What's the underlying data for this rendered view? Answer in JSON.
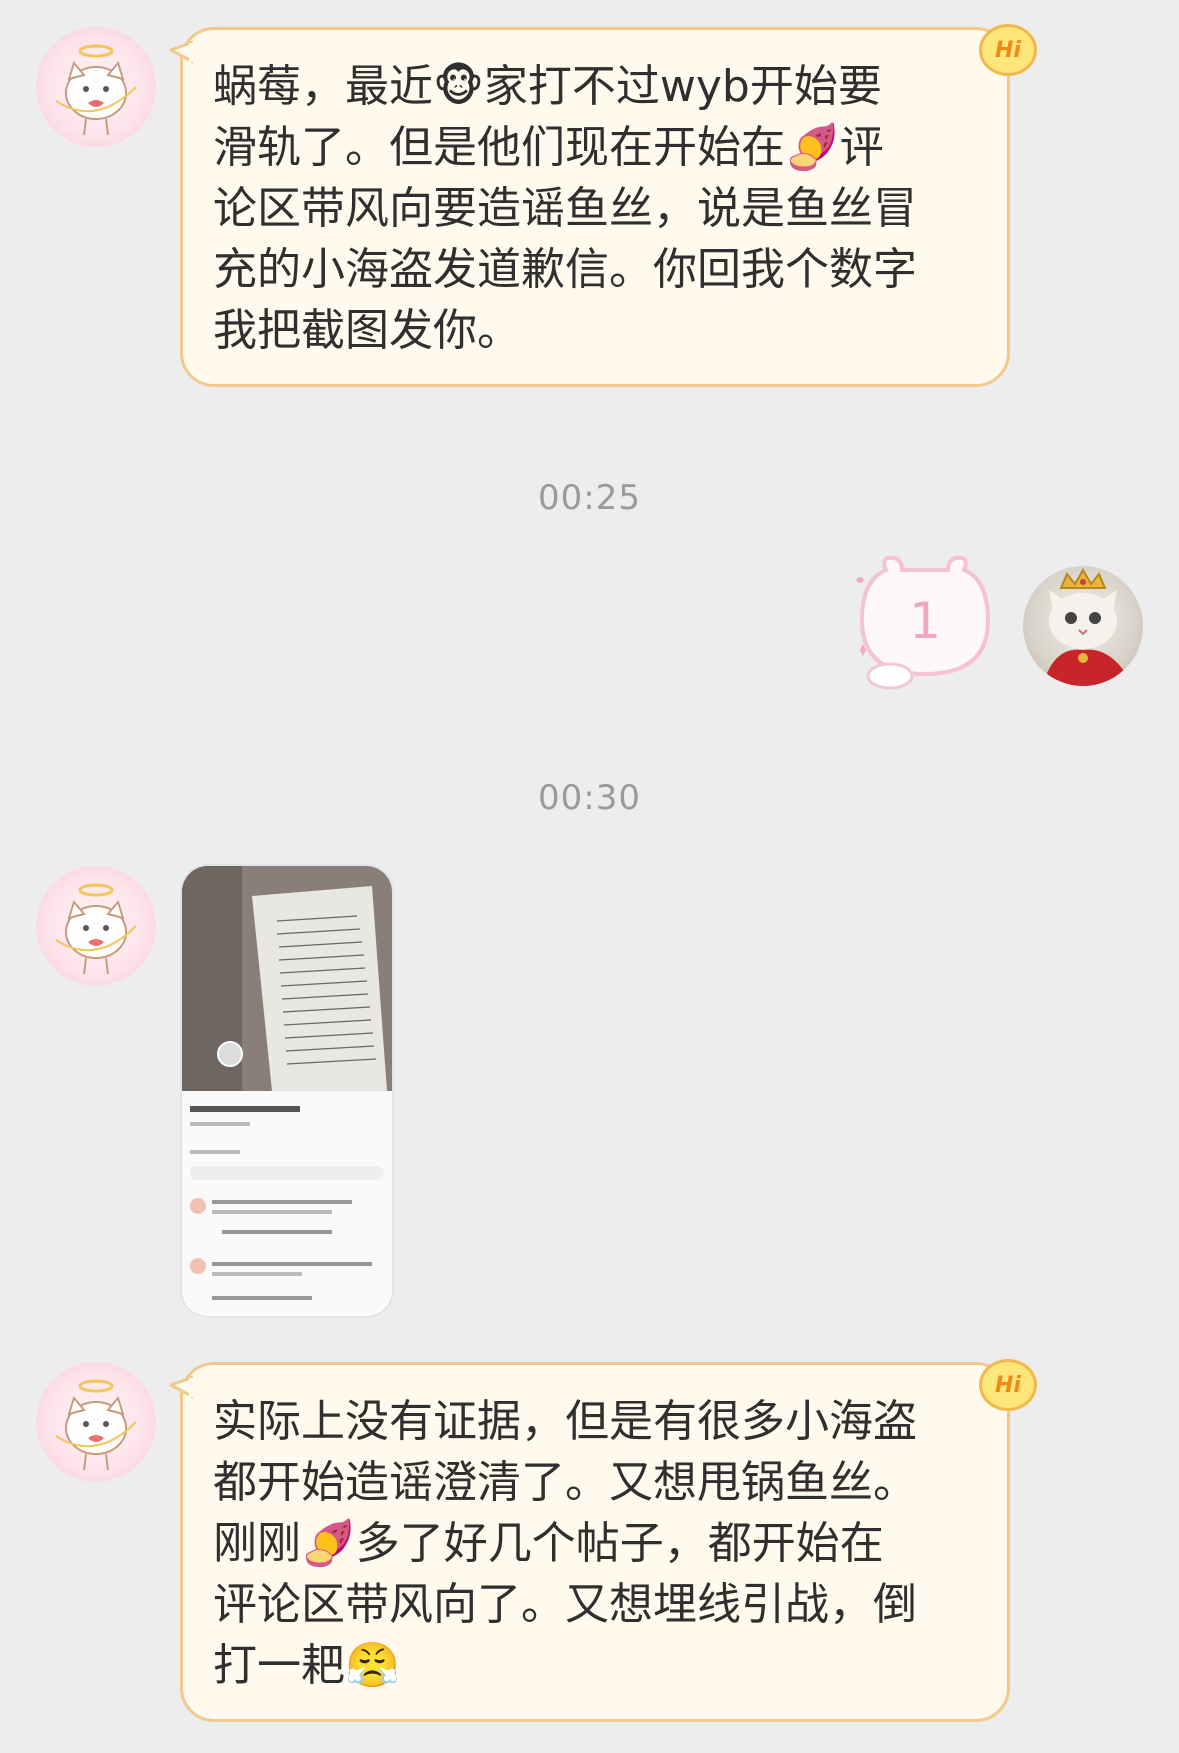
{
  "messages": [
    {
      "sender": "contact",
      "text": "蜗莓，最近🐵家打不过wyb开始要\n滑轨了。但是他们现在开始在🍠评\n论区带风向要造谣鱼丝，说是鱼丝冒\n充的小海盗发道歉信。你回我个数字\n我把截图发你。"
    },
    {
      "timestamp": "00:25"
    },
    {
      "sender": "me",
      "sticker_text": "1"
    },
    {
      "timestamp": "00:30"
    },
    {
      "sender": "contact",
      "type": "image"
    },
    {
      "sender": "contact",
      "text": "实际上没有证据，但是有很多小海盗\n都开始造谣澄清了。又想甩锅鱼丝。\n刚刚🍠多了好几个帖子，都开始在\n评论区带风向了。又想埋线引战，倒\n打一耙😤"
    }
  ],
  "badge": {
    "label": "Hi"
  },
  "colors": {
    "background": "#ededed",
    "bubble_fill": "#fffaed",
    "bubble_border": "#f2c98b",
    "badge": "#ffe67a",
    "timestamp": "#9a9a9a"
  },
  "icons": [
    "angel-cat-avatar",
    "crown-cat-avatar",
    "hi-badge",
    "bear-sticker",
    "screenshot-thumbnail"
  ]
}
